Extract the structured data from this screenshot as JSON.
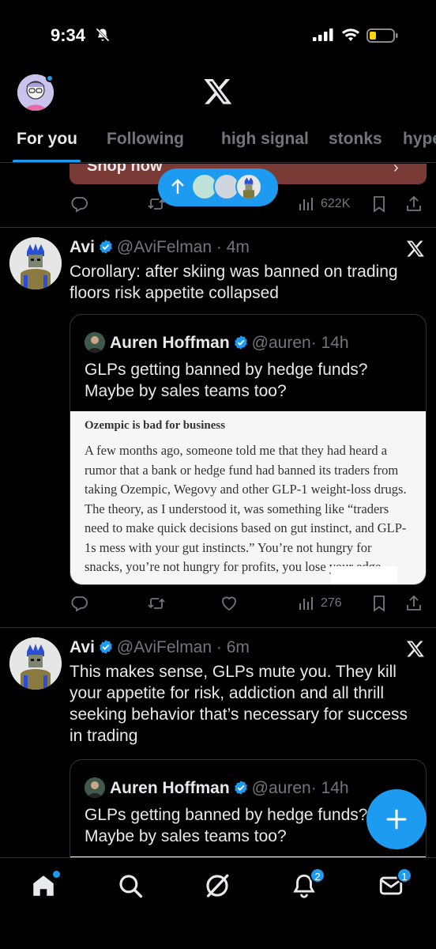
{
  "status_bar": {
    "time": "9:34"
  },
  "tabs": [
    {
      "label": "For you"
    },
    {
      "label": "Following"
    },
    {
      "label": "high signal"
    },
    {
      "label": "stonks"
    },
    {
      "label": "hype"
    }
  ],
  "promo": {
    "label": "Shop now"
  },
  "promo_actions": {
    "views": "622K"
  },
  "tweet1": {
    "name": "Avi",
    "handle": "@AviFelman",
    "time": "· 4m",
    "text": "Corollary: after skiing was banned on trading floors risk appetite collapsed",
    "quote": {
      "name": "Auren Hoffman",
      "handle": "@auren",
      "time": "· 14h",
      "text": "GLPs getting banned by hedge funds? Maybe by sales teams too?",
      "article_title": "Ozempic is bad for business",
      "article_body": "A few months ago, someone told me that they had heard a rumor that a bank or hedge fund had banned its traders from taking Ozempic, Wegovy and other GLP-1 weight-loss drugs. The theory, as I understood it, was something like “traders need to make quick decisions based on gut instinct, and GLP-1s mess with your gut instincts.” You’re not hungry for snacks, you’re not hungry for profits, you lose your edge."
    },
    "views": "276"
  },
  "tweet2": {
    "name": "Avi",
    "handle": "@AviFelman",
    "time": "· 6m",
    "text": "This makes sense, GLPs mute you. They kill your appetite for risk, addiction and all thrill seeking behavior that’s necessary for success in trading",
    "quote": {
      "name": "Auren Hoffman",
      "handle": "@auren",
      "time": "· 14h",
      "text": "GLPs getting banned by hedge funds? Maybe by sales teams too?"
    }
  },
  "bottom_nav": {
    "notifications_badge": "2",
    "messages_badge": "1"
  },
  "colors": {
    "accent": "#1d9bf0",
    "background": "#000000",
    "muted": "#71767b",
    "promo": "#7a3b37"
  }
}
